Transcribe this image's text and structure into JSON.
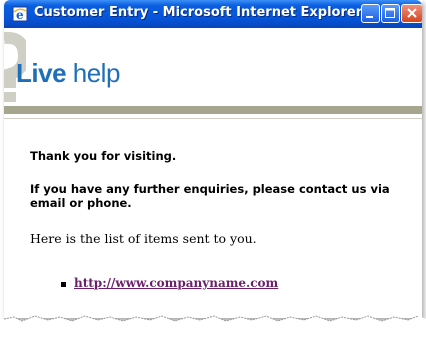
{
  "window": {
    "title": "Customer Entry - Microsoft Internet Explorer"
  },
  "header": {
    "logo_word1": "Live",
    "logo_word2": " help"
  },
  "content": {
    "thanks": "Thank you for visiting.",
    "enquiry_line1": "If you have any further enquiries, please contact us via",
    "enquiry_line2": "email or phone.",
    "list_intro": "Here is the list of items sent to you.",
    "items": [
      {
        "url": "http://www.companyname.com"
      }
    ]
  },
  "colors": {
    "titlebar": "#0653d6",
    "logo": "#1f6fb8",
    "header_bar": "#a6a58d",
    "link": "#6b1f6b"
  },
  "icons": {
    "app": "ie-icon",
    "minimize": "minimize-icon",
    "maximize": "maximize-icon",
    "close": "close-icon"
  }
}
